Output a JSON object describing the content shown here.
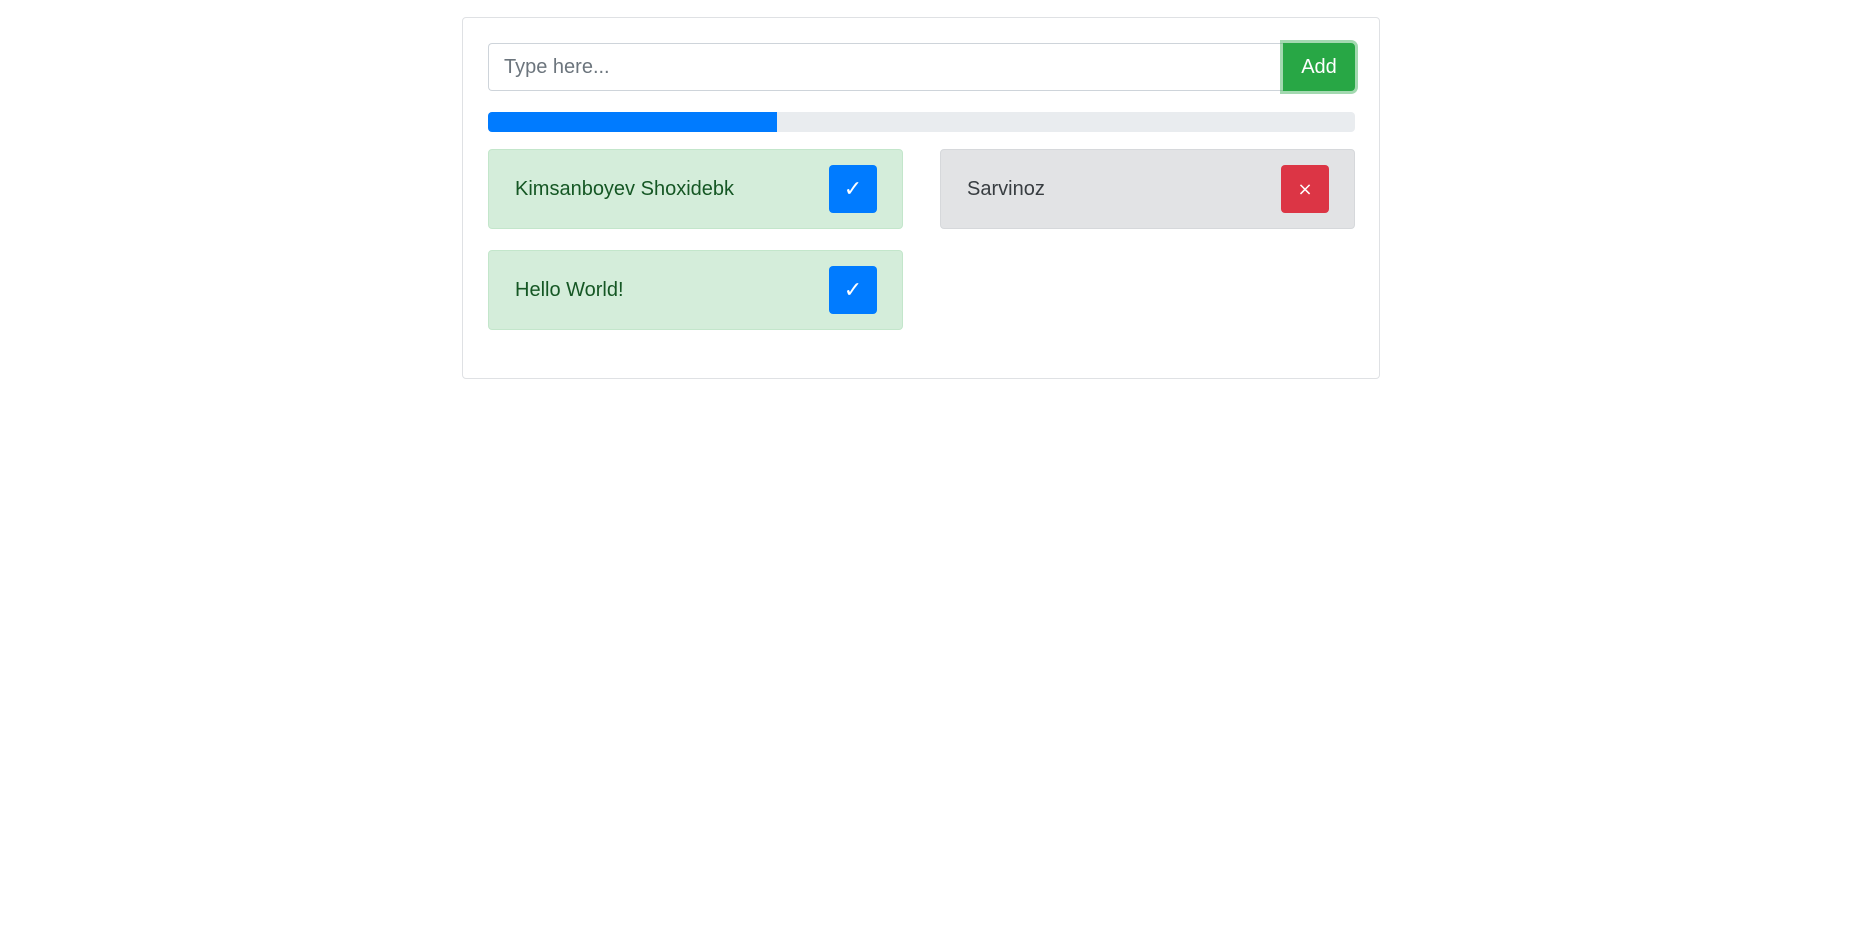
{
  "form": {
    "input_placeholder": "Type here...",
    "input_value": "",
    "add_label": "Add"
  },
  "progress": {
    "percent": 33.3,
    "color": "#007bff"
  },
  "items": [
    {
      "label": "Kimsanboyev Shoxidebk",
      "status": "done",
      "action_icon": "checkmark-icon",
      "action_symbol": "✓"
    },
    {
      "label": "Sarvinoz",
      "status": "pending",
      "action_icon": "close-icon",
      "action_symbol": "×"
    },
    {
      "label": "Hello World!",
      "status": "done",
      "action_icon": "checkmark-icon",
      "action_symbol": "✓"
    }
  ],
  "colors": {
    "add_button": "#28a745",
    "check_button": "#007bff",
    "remove_button": "#dc3545",
    "done_background": "#d4edda",
    "pending_background": "#e2e3e5"
  }
}
